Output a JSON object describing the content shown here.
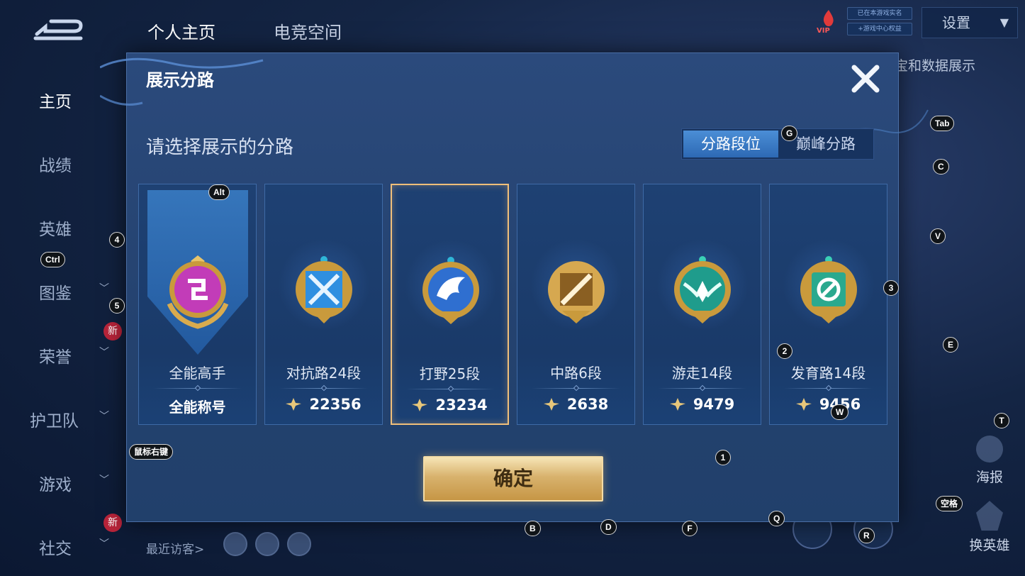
{
  "background": {
    "top_tabs": [
      {
        "label": "个人主页",
        "active": true
      },
      {
        "label": "电竞空间",
        "active": false
      }
    ],
    "vip": {
      "label": "VIP",
      "line1": "已在本游戏实名",
      "line2": "+游戏中心权益"
    },
    "settings": {
      "label": "设置"
    },
    "right_hint": "宝和数据展示",
    "sidebar": [
      {
        "label": "主页",
        "active": true,
        "has_chevron": false,
        "new": false
      },
      {
        "label": "战绩",
        "active": false,
        "has_chevron": false,
        "new": false
      },
      {
        "label": "英雄",
        "active": false,
        "has_chevron": false,
        "new": false
      },
      {
        "label": "图鉴",
        "active": false,
        "has_chevron": true,
        "new": false
      },
      {
        "label": "荣誉",
        "active": false,
        "has_chevron": true,
        "new": true
      },
      {
        "label": "护卫队",
        "active": false,
        "has_chevron": true,
        "new": false
      },
      {
        "label": "游戏",
        "active": false,
        "has_chevron": true,
        "new": false
      },
      {
        "label": "社交",
        "active": false,
        "has_chevron": true,
        "new": true
      }
    ],
    "new_badge": "新",
    "recent_visitors": "最近访客>",
    "poster": "海报",
    "change_hero": "换英雄"
  },
  "modal": {
    "title": "展示分路",
    "prompt": "请选择展示的分路",
    "toggle": {
      "active": "分路段位",
      "inactive": "巅峰分路"
    },
    "cards": [
      {
        "label": "全能高手",
        "value": "全能称号",
        "type": "title",
        "emblem": "all-rounder-emblem",
        "color": "#c23cb8",
        "selected": false
      },
      {
        "label": "对抗路24段",
        "value": "22356",
        "type": "score",
        "emblem": "clash-lane-emblem",
        "color": "#2f8fe0",
        "selected": false
      },
      {
        "label": "打野25段",
        "value": "23234",
        "type": "score",
        "emblem": "jungle-emblem",
        "color": "#2f6fd0",
        "selected": true
      },
      {
        "label": "中路6段",
        "value": "2638",
        "type": "score",
        "emblem": "mid-lane-emblem",
        "color": "#b8873a",
        "selected": false
      },
      {
        "label": "游走14段",
        "value": "9479",
        "type": "score",
        "emblem": "roam-emblem",
        "color": "#1f9c8c",
        "selected": false
      },
      {
        "label": "发育路14段",
        "value": "9456",
        "type": "score",
        "emblem": "farm-lane-emblem",
        "color": "#2aa98e",
        "selected": false
      }
    ],
    "confirm": "确定"
  },
  "key_hints": [
    {
      "key": "Alt"
    },
    {
      "key": "Ctrl"
    },
    {
      "key": "4"
    },
    {
      "key": "5"
    },
    {
      "key": "G"
    },
    {
      "key": "Tab"
    },
    {
      "key": "C"
    },
    {
      "key": "V"
    },
    {
      "key": "3"
    },
    {
      "key": "E"
    },
    {
      "key": "2"
    },
    {
      "key": "W"
    },
    {
      "key": "T"
    },
    {
      "key": "1"
    },
    {
      "key": "鼠标右键"
    },
    {
      "key": "空格"
    },
    {
      "key": "Q"
    },
    {
      "key": "B"
    },
    {
      "key": "D"
    },
    {
      "key": "F"
    },
    {
      "key": "R"
    }
  ]
}
